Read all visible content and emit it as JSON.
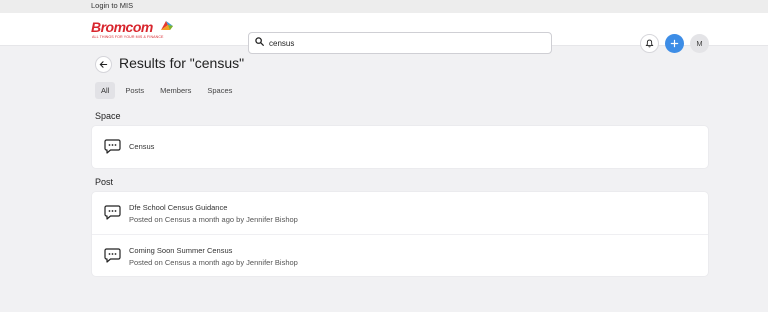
{
  "topbar": {
    "login_link": "Login to MIS"
  },
  "header": {
    "brand": "Bromcom",
    "tagline": "ALL THINGS FOR YOUR MIS & FINANCE",
    "search": {
      "value": "census",
      "placeholder": ""
    },
    "avatar_initial": "M",
    "icons": [
      "search-icon",
      "bell-icon",
      "plus-icon"
    ],
    "accent_color": "#3d8de6",
    "brand_color": "#d8262e"
  },
  "page": {
    "title": "Results for \"census\"",
    "tabs": [
      {
        "label": "All",
        "active": true
      },
      {
        "label": "Posts",
        "active": false
      },
      {
        "label": "Members",
        "active": false
      },
      {
        "label": "Spaces",
        "active": false
      }
    ]
  },
  "sections": {
    "space": {
      "heading": "Space",
      "items": [
        {
          "title": "Census"
        }
      ]
    },
    "post": {
      "heading": "Post",
      "items": [
        {
          "title": "Dfe School Census Guidance",
          "meta": "Posted on Census a month ago by Jennifer Bishop"
        },
        {
          "title": "Coming Soon Summer Census",
          "meta": "Posted on Census a month ago by Jennifer Bishop"
        }
      ]
    }
  }
}
